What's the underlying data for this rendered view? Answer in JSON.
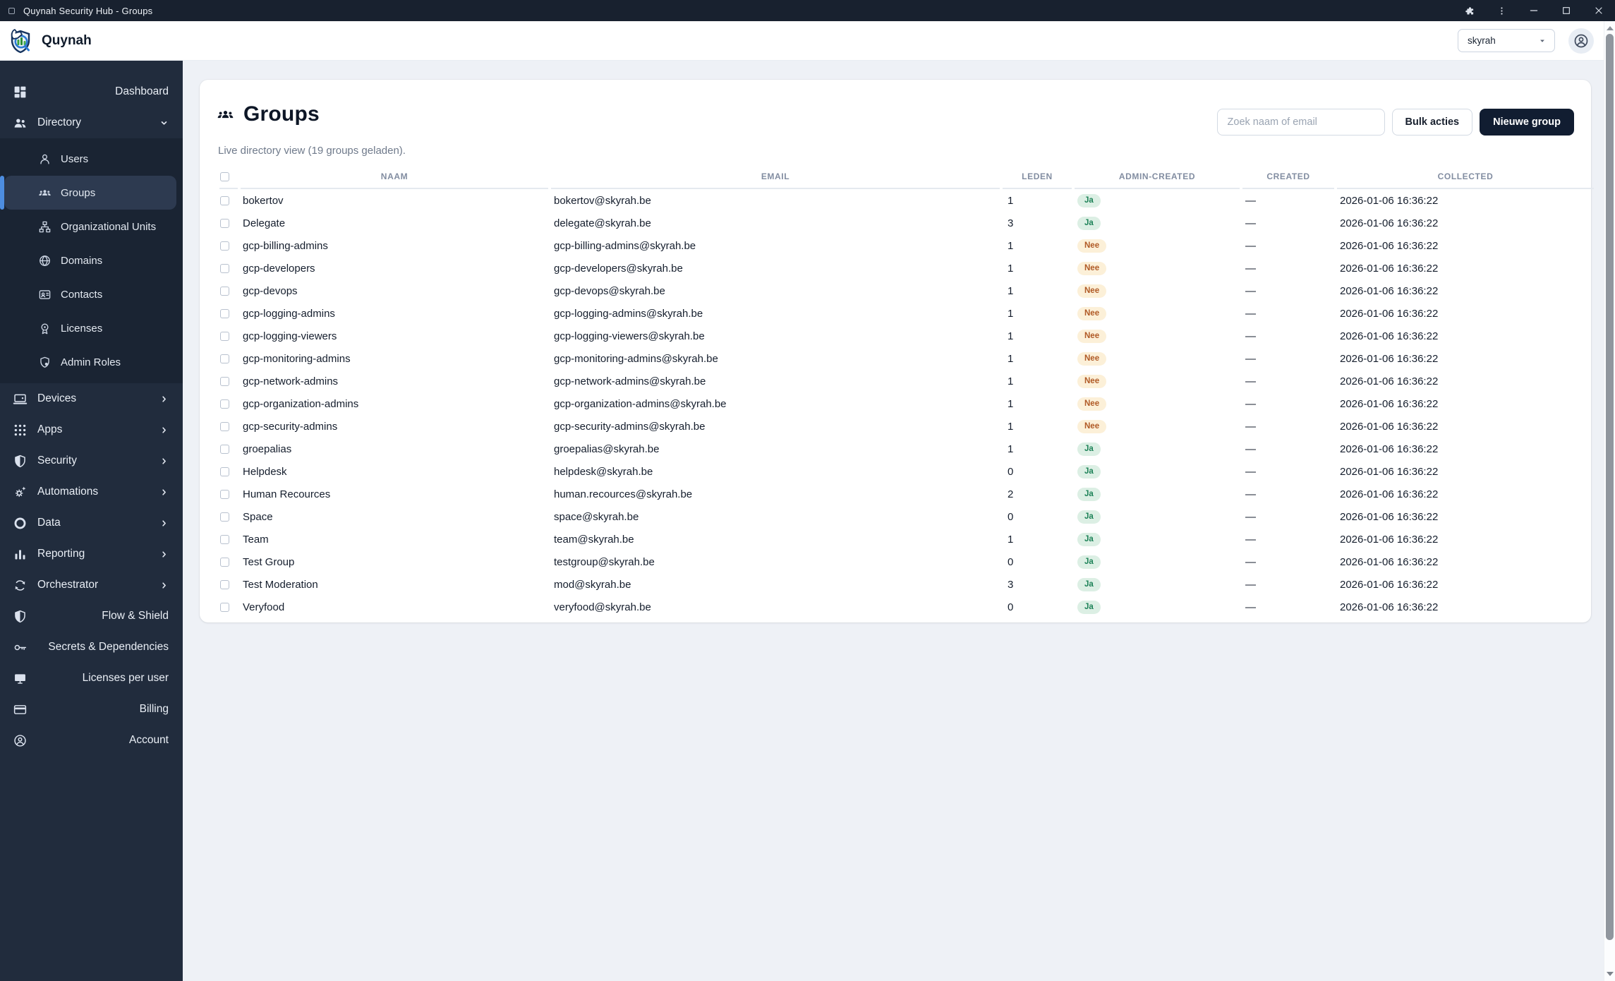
{
  "window": {
    "title": "Quynah Security Hub - Groups"
  },
  "header": {
    "brand": "Quynah",
    "org_selector": {
      "value": "skyrah"
    }
  },
  "sidebar": {
    "items": [
      {
        "label": "Dashboard",
        "icon": "dashboard-icon"
      },
      {
        "label": "Directory",
        "icon": "directory-icon",
        "expanded": true,
        "children": [
          {
            "label": "Users",
            "icon": "user-icon"
          },
          {
            "label": "Groups",
            "icon": "groups-icon",
            "active": true
          },
          {
            "label": "Organizational Units",
            "icon": "org-units-icon"
          },
          {
            "label": "Domains",
            "icon": "globe-icon"
          },
          {
            "label": "Contacts",
            "icon": "contact-card-icon"
          },
          {
            "label": "Licenses",
            "icon": "license-badge-icon"
          },
          {
            "label": "Admin Roles",
            "icon": "admin-shield-icon"
          }
        ]
      },
      {
        "label": "Devices",
        "icon": "devices-icon",
        "expandable": true
      },
      {
        "label": "Apps",
        "icon": "apps-grid-icon",
        "expandable": true
      },
      {
        "label": "Security",
        "icon": "shield-icon",
        "expandable": true
      },
      {
        "label": "Automations",
        "icon": "gear-sparkle-icon",
        "expandable": true
      },
      {
        "label": "Data",
        "icon": "data-ring-icon",
        "expandable": true
      },
      {
        "label": "Reporting",
        "icon": "bar-chart-icon",
        "expandable": true
      },
      {
        "label": "Orchestrator",
        "icon": "sync-icon",
        "expandable": true
      },
      {
        "label": "Flow & Shield",
        "icon": "shield-icon"
      },
      {
        "label": "Secrets & Dependencies",
        "icon": "key-icon"
      },
      {
        "label": "Licenses per user",
        "icon": "monitor-icon"
      },
      {
        "label": "Billing",
        "icon": "credit-card-icon"
      },
      {
        "label": "Account",
        "icon": "account-circle-icon"
      }
    ]
  },
  "page": {
    "title": "Groups",
    "title_icon": "groups-icon",
    "subtitle": "Live directory view (19 groups geladen).",
    "search_placeholder": "Zoek naam of email",
    "bulk_button": "Bulk acties",
    "new_button": "Nieuwe group"
  },
  "table": {
    "columns": [
      "NAAM",
      "EMAIL",
      "LEDEN",
      "ADMIN-CREATED",
      "CREATED",
      "COLLECTED"
    ],
    "rows": [
      {
        "name": "bokertov",
        "email": "bokertov@skyrah.be",
        "leden": "1",
        "admin_created": "Ja",
        "created": "—",
        "collected": "2026-01-06 16:36:22"
      },
      {
        "name": "Delegate",
        "email": "delegate@skyrah.be",
        "leden": "3",
        "admin_created": "Ja",
        "created": "—",
        "collected": "2026-01-06 16:36:22"
      },
      {
        "name": "gcp-billing-admins",
        "email": "gcp-billing-admins@skyrah.be",
        "leden": "1",
        "admin_created": "Nee",
        "created": "—",
        "collected": "2026-01-06 16:36:22"
      },
      {
        "name": "gcp-developers",
        "email": "gcp-developers@skyrah.be",
        "leden": "1",
        "admin_created": "Nee",
        "created": "—",
        "collected": "2026-01-06 16:36:22"
      },
      {
        "name": "gcp-devops",
        "email": "gcp-devops@skyrah.be",
        "leden": "1",
        "admin_created": "Nee",
        "created": "—",
        "collected": "2026-01-06 16:36:22"
      },
      {
        "name": "gcp-logging-admins",
        "email": "gcp-logging-admins@skyrah.be",
        "leden": "1",
        "admin_created": "Nee",
        "created": "—",
        "collected": "2026-01-06 16:36:22"
      },
      {
        "name": "gcp-logging-viewers",
        "email": "gcp-logging-viewers@skyrah.be",
        "leden": "1",
        "admin_created": "Nee",
        "created": "—",
        "collected": "2026-01-06 16:36:22"
      },
      {
        "name": "gcp-monitoring-admins",
        "email": "gcp-monitoring-admins@skyrah.be",
        "leden": "1",
        "admin_created": "Nee",
        "created": "—",
        "collected": "2026-01-06 16:36:22"
      },
      {
        "name": "gcp-network-admins",
        "email": "gcp-network-admins@skyrah.be",
        "leden": "1",
        "admin_created": "Nee",
        "created": "—",
        "collected": "2026-01-06 16:36:22"
      },
      {
        "name": "gcp-organization-admins",
        "email": "gcp-organization-admins@skyrah.be",
        "leden": "1",
        "admin_created": "Nee",
        "created": "—",
        "collected": "2026-01-06 16:36:22"
      },
      {
        "name": "gcp-security-admins",
        "email": "gcp-security-admins@skyrah.be",
        "leden": "1",
        "admin_created": "Nee",
        "created": "—",
        "collected": "2026-01-06 16:36:22"
      },
      {
        "name": "groepalias",
        "email": "groepalias@skyrah.be",
        "leden": "1",
        "admin_created": "Ja",
        "created": "—",
        "collected": "2026-01-06 16:36:22"
      },
      {
        "name": "Helpdesk",
        "email": "helpdesk@skyrah.be",
        "leden": "0",
        "admin_created": "Ja",
        "created": "—",
        "collected": "2026-01-06 16:36:22"
      },
      {
        "name": "Human Recources",
        "email": "human.recources@skyrah.be",
        "leden": "2",
        "admin_created": "Ja",
        "created": "—",
        "collected": "2026-01-06 16:36:22"
      },
      {
        "name": "Space",
        "email": "space@skyrah.be",
        "leden": "0",
        "admin_created": "Ja",
        "created": "—",
        "collected": "2026-01-06 16:36:22"
      },
      {
        "name": "Team",
        "email": "team@skyrah.be",
        "leden": "1",
        "admin_created": "Ja",
        "created": "—",
        "collected": "2026-01-06 16:36:22"
      },
      {
        "name": "Test Group",
        "email": "testgroup@skyrah.be",
        "leden": "0",
        "admin_created": "Ja",
        "created": "—",
        "collected": "2026-01-06 16:36:22"
      },
      {
        "name": "Test Moderation",
        "email": "mod@skyrah.be",
        "leden": "3",
        "admin_created": "Ja",
        "created": "—",
        "collected": "2026-01-06 16:36:22"
      },
      {
        "name": "Veryfood",
        "email": "veryfood@skyrah.be",
        "leden": "0",
        "admin_created": "Ja",
        "created": "—",
        "collected": "2026-01-06 16:36:22"
      }
    ]
  },
  "colors": {
    "accent_blue": "#4d8de0",
    "sidebar_bg": "#212c3d",
    "titlebar_bg": "#18212f",
    "primary_button_bg": "#111d31",
    "badge_ja_bg": "#dcefe4",
    "badge_ja_text": "#1d8257",
    "badge_nee_bg": "#fcf0d8",
    "badge_nee_text": "#b05a26"
  }
}
